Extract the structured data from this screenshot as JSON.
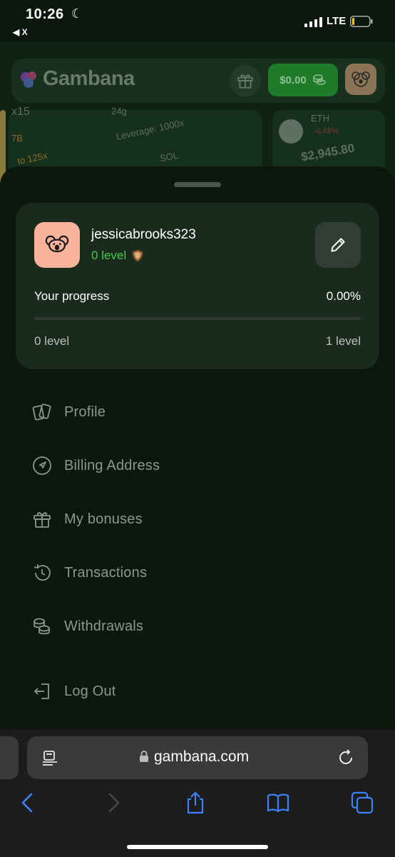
{
  "status_bar": {
    "time": "10:26",
    "back_app": "◀ X",
    "network": "LTE"
  },
  "background_page": {
    "brand": "Gambana",
    "balance": "$0.00",
    "fragments": {
      "f1": "x15",
      "f2": "24g",
      "f3": "Leverage: 1000x",
      "f4": "7B",
      "f5": "to 125x",
      "f6": "SOL",
      "f7": "ETH",
      "f8": "-0.68%",
      "f9": "$2,945.80"
    }
  },
  "profile": {
    "username": "jessicabrooks323",
    "level": "0 level",
    "progress_label": "Your progress",
    "progress_value": "0.00%",
    "progress_fraction": 0.0,
    "current_level": "0 level",
    "next_level": "1 level"
  },
  "menu": {
    "items": [
      {
        "label": "Profile",
        "icon": "cards-icon"
      },
      {
        "label": "Billing Address",
        "icon": "location-arrow-icon"
      },
      {
        "label": "My bonuses",
        "icon": "gift-icon"
      },
      {
        "label": "Transactions",
        "icon": "history-icon"
      },
      {
        "label": "Withdrawals",
        "icon": "coins-icon"
      }
    ],
    "logout": {
      "label": "Log Out",
      "icon": "logout-icon"
    }
  },
  "browser": {
    "url": "gambana.com"
  },
  "colors": {
    "accent": "#3fcc4b",
    "sheet": "#0b170d",
    "card": "#1a2b1e",
    "avatar": "#f9b29b",
    "browser_blue": "#3b82f6"
  }
}
